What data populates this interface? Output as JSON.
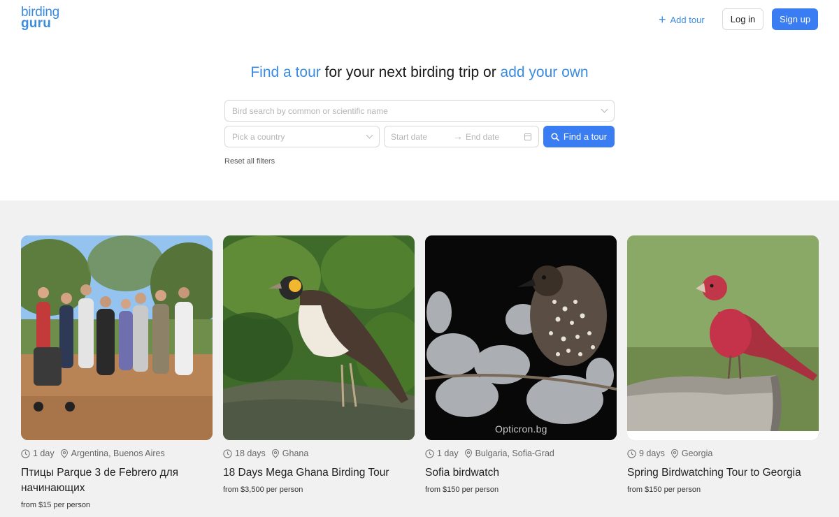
{
  "header": {
    "logo_line1": "birding",
    "logo_line2": "guru",
    "add_tour_label": "Add tour",
    "login_label": "Log in",
    "signup_label": "Sign up"
  },
  "hero": {
    "title_part1": "Find a tour",
    "title_part2": " for your next birding trip or ",
    "title_part3": "add your own",
    "search_placeholder": "Bird search by common or scientific name",
    "country_placeholder": "Pick a country",
    "start_date_placeholder": "Start date",
    "end_date_placeholder": "End date",
    "find_button_label": "Find a tour",
    "reset_label": "Reset all filters"
  },
  "colors": {
    "accent": "#3b8ce0",
    "primary_button": "#3a7cf2",
    "section_bg": "#f1f1f1"
  },
  "tours": [
    {
      "duration": "1 day",
      "location": "Argentina, Buenos Aires",
      "title": "Птицы Parque 3 de Febrero для начинающих",
      "price": "from $15 per person",
      "icons": [
        "clock-icon",
        "location-pin-icon"
      ]
    },
    {
      "duration": "18 days",
      "location": "Ghana",
      "title": "18 Days Mega Ghana Birding Tour",
      "price": "from $3,500 per person",
      "icons": [
        "clock-icon",
        "location-pin-icon"
      ]
    },
    {
      "duration": "1 day",
      "location": "Bulgaria, Sofia-Grad",
      "title": "Sofia birdwatch",
      "price": "from $150 per person",
      "watermark": "Opticron.bg",
      "icons": [
        "clock-icon",
        "location-pin-icon"
      ]
    },
    {
      "duration": "9 days",
      "location": "Georgia",
      "title": "Spring Birdwatching Tour to Georgia",
      "price": "from $150 per person",
      "icons": [
        "clock-icon",
        "location-pin-icon"
      ]
    }
  ]
}
